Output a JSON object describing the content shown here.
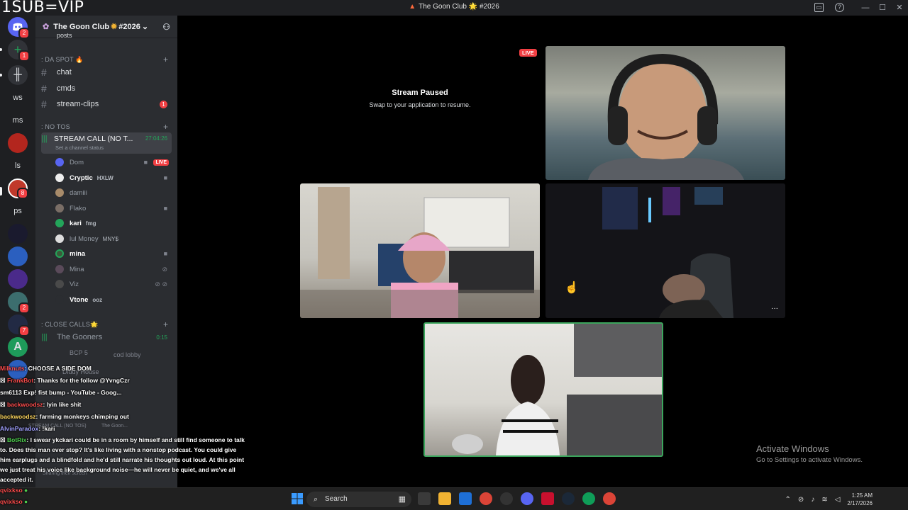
{
  "overlay": {
    "banner": "1SUB=VIP"
  },
  "window": {
    "title": "The Goon Club 🌟 #2026",
    "controls": {
      "minimize": "—",
      "maximize": "☐",
      "close": "✕"
    }
  },
  "rail": {
    "servers": [
      {
        "label": "ws"
      },
      {
        "label": "ms"
      },
      {
        "label": "ls"
      },
      {
        "label": "ps"
      }
    ],
    "badges": [
      "2",
      "1",
      "8",
      "2",
      "7",
      "2",
      "8"
    ]
  },
  "sidebar": {
    "guild_name": "The Goon Club",
    "guild_suffix": "#2026",
    "partial_channel": "posts",
    "categories": [
      {
        "label": ": DA SPOT 🔥"
      },
      {
        "label": ": NO TOS"
      },
      {
        "label": ": CLOSE CALLS🌟"
      }
    ],
    "channels": [
      {
        "name": "chat"
      },
      {
        "name": "cmds"
      },
      {
        "name": "stream-clips",
        "unread": "1"
      }
    ],
    "voice_channel": {
      "name": "STREAM CALL (NO T...",
      "timer": "27:04:26",
      "status": "Set a channel status"
    },
    "members": [
      {
        "name": "Dom",
        "badge": "LIVE",
        "color": "#c9cdfb"
      },
      {
        "name": "Cryptic",
        "tag": "HXLW",
        "color": "#ffffff"
      },
      {
        "name": "damiii",
        "color": "#949ba4"
      },
      {
        "name": "Flako",
        "color": "#949ba4"
      },
      {
        "name": "kari",
        "tag": "fmg",
        "color": "#ffffff"
      },
      {
        "name": "lul Money",
        "tag": "MNY$",
        "color": "#949ba4"
      },
      {
        "name": "mina",
        "color": "#ffffff"
      },
      {
        "name": "Mina",
        "color": "#949ba4"
      },
      {
        "name": "Viz",
        "color": "#949ba4"
      },
      {
        "name": "Vtone",
        "tag": "ooz",
        "color": "#ffffff"
      }
    ],
    "close_calls_channel": {
      "name": "The Gooners",
      "timer": "0:15"
    }
  },
  "chat_overlay": {
    "messages": [
      {
        "user": "Milknuts",
        "text": ": CHOOSE A SIDE DOM"
      },
      {
        "user": "FrankBot",
        "text": ": Thanks for the follow @YvngCzr"
      },
      {
        "user": "sm6113",
        "text": "Exp!  fist bump - YouTube - Goog..."
      },
      {
        "user": "backwoodsz",
        "text": ": lyin like shit"
      },
      {
        "user": "backwoodsz",
        "text": ": farming monkeys chimping out"
      },
      {
        "user": "AlvinParadox",
        "text": ": !kari"
      },
      {
        "user": "BotRix",
        "text": ": I swear ykckari could be in a room by himself and still find someone to talk to. Does this man ever stop? It's like living with a nonstop podcast. You could give him earplugs and a blindfold and he'd still narrate his thoughts out loud. At this point we just treat his voice like background noise—he will never be quiet, and we've all accepted it."
      },
      {
        "user": "qvixkso",
        "text": ""
      },
      {
        "user": "qvixkso",
        "text": ""
      }
    ],
    "ghost_items": [
      "BCP 5",
      "cod lobby",
      "Diddy House",
      "Sharing their screen",
      "STREAM CALL (NO TOS)",
      "The Goon..."
    ]
  },
  "stage": {
    "paused_title": "Stream Paused",
    "paused_subtitle": "Swap to your application to resume.",
    "live_label": "LIVE",
    "more_label": "···"
  },
  "activation": {
    "title": "Activate Windows",
    "subtitle": "Go to Settings to activate Windows."
  },
  "taskbar": {
    "search_placeholder": "Search",
    "time": "1:25 AM",
    "date": "2/17/2026"
  },
  "colors": {
    "accent": "#5865f2",
    "live_red": "#f23f43",
    "voice_green": "#23a55a",
    "speaking_border": "#3ba55c"
  }
}
